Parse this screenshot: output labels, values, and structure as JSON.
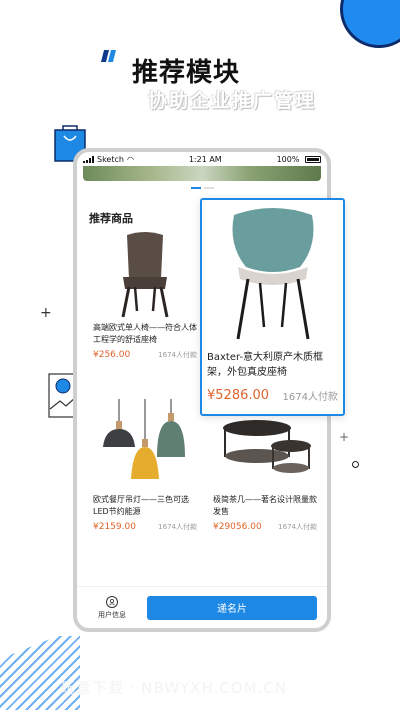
{
  "header": {
    "title": "推荐模块",
    "subtitle": "协助企业推广管理"
  },
  "phone": {
    "status": {
      "carrier": "Sketch",
      "time": "1:21 AM",
      "battery": "100%"
    },
    "section_title": "推荐商品",
    "products": [
      {
        "name": "高端欧式单人椅——符合人体工程学的舒适座椅",
        "price": "¥256.00",
        "count": "1674人付款"
      },
      {
        "name": "欧式餐厅吊灯——三色可选LED节约能源",
        "price": "¥2159.00",
        "count": "1674人付款"
      },
      {
        "name": "极简茶几——著名设计限量款发售",
        "price": "¥29056.00",
        "count": "1674人付款"
      }
    ],
    "featured": {
      "name": "Baxter-意大利原产木质框架，外包真皮座椅",
      "price": "¥5286.00",
      "count": "1674人付款"
    },
    "tabbar": {
      "user_label": "用户信息",
      "card_button": "递名片"
    }
  },
  "watermark": "玩意下载 · NBWYXH.COM.CN",
  "colors": {
    "accent": "#1e88e5",
    "price": "#e0632c"
  }
}
